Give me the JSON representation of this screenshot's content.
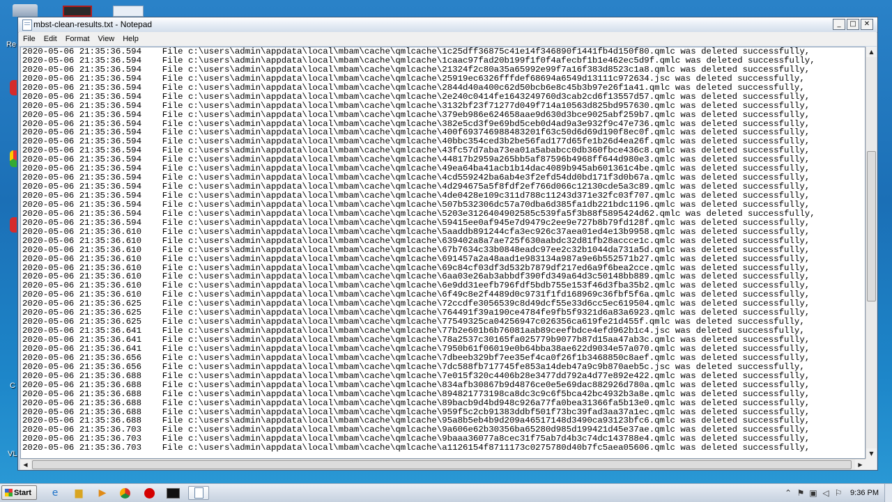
{
  "desktop": {
    "label_fragments": [
      "Re",
      "C",
      "VL"
    ]
  },
  "window": {
    "title": "mbst-clean-results.txt - Notepad",
    "menu": [
      "File",
      "Edit",
      "Format",
      "View",
      "Help"
    ],
    "controls": {
      "minimize": "_",
      "maximize": "□",
      "close": "✕"
    }
  },
  "editor": {
    "path_prefix": "c:\\users\\admin\\appdata\\local\\mbam\\cache\\qmlcache\\",
    "lines": [
      {
        "date": "2020-05-06",
        "time": "21:35:36.594",
        "file": "1c25dff36875c41e14f346890f1441fb4d150f80.qmlc",
        "status": "was deleted successfully,"
      },
      {
        "date": "2020-05-06",
        "time": "21:35:36.594",
        "file": "1caac97fad20b199f1f0f4afecbf1b1e462ec5d9f.qmlc",
        "status": "was deleted successfully,"
      },
      {
        "date": "2020-05-06",
        "time": "21:35:36.594",
        "file": "21324f2c80a35a65992e99f7a16f383d8523c1a8.qmlc",
        "status": "was deleted successfully,"
      },
      {
        "date": "2020-05-06",
        "time": "21:35:36.594",
        "file": "25919ec6326fffdef68694a6549d13111c972634.jsc",
        "status": "was deleted successfully,"
      },
      {
        "date": "2020-05-06",
        "time": "21:35:36.594",
        "file": "2844d40a400c62d50bcb6e8c45b3b97e26f1a41.qmlc",
        "status": "was deleted successfully,"
      },
      {
        "date": "2020-05-06",
        "time": "21:35:36.594",
        "file": "2e240c0414fe1643249760d3cab2cd6f13557d57.qmlc",
        "status": "was deleted successfully,"
      },
      {
        "date": "2020-05-06",
        "time": "21:35:36.594",
        "file": "3132bf23f71277d049f714a10563d825bd957630.qmlc",
        "status": "was deleted successfully,"
      },
      {
        "date": "2020-05-06",
        "time": "21:35:36.594",
        "file": "379eb986e624658aae9d630d3bce9025abf259b7.qmlc",
        "status": "was deleted successfully,"
      },
      {
        "date": "2020-05-06",
        "time": "21:35:36.594",
        "file": "382e5cd3f9e69bd5ceb0d4ad9a3e932f9c47e736.qmlc",
        "status": "was deleted successfully,"
      },
      {
        "date": "2020-05-06",
        "time": "21:35:36.594",
        "file": "400f693746988483201f63c50d6d69d190f8ec0f.qmlc",
        "status": "was deleted successfully,"
      },
      {
        "date": "2020-05-06",
        "time": "21:35:36.594",
        "file": "40bbc354ced3b2be56fad177d65fe1b26d4ea26f.qmlc",
        "status": "was deleted successfully,"
      },
      {
        "date": "2020-05-06",
        "time": "21:35:36.594",
        "file": "43fc57d7aba73ea01a5ababcc0db360fbce436c8.qmlc",
        "status": "was deleted successfully,"
      },
      {
        "date": "2020-05-06",
        "time": "21:35:36.594",
        "file": "44817b2959a265bb5af87596b4968ff644d980e3.qmlc",
        "status": "was deleted successfully,"
      },
      {
        "date": "2020-05-06",
        "time": "21:35:36.594",
        "file": "49ea64ba41acb1b14dac4089b945ab601361c4be.qmlc",
        "status": "was deleted successfully,"
      },
      {
        "date": "2020-05-06",
        "time": "21:35:36.594",
        "file": "4cd559242ba6ab4e3f2efd54dd0bd171f3d0b67a.qmlc",
        "status": "was deleted successfully,"
      },
      {
        "date": "2020-05-06",
        "time": "21:35:36.594",
        "file": "4d294675a5f8fdf2ef766d066c12130cde5a3c89.qmlc",
        "status": "was deleted successfully,"
      },
      {
        "date": "2020-05-06",
        "time": "21:35:36.594",
        "file": "4de0428e109c311d788c11243d371e32fc03f707.qmlc",
        "status": "was deleted successfully,"
      },
      {
        "date": "2020-05-06",
        "time": "21:35:36.594",
        "file": "507b532306dc57a70dba6d385fa1db221bdc1196.qmlc",
        "status": "was deleted successfully,"
      },
      {
        "date": "2020-05-06",
        "time": "21:35:36.594",
        "file": "5203e3126404902585c539fa5f3b88f5895424d62.qmlc",
        "status": "was deleted successfully,"
      },
      {
        "date": "2020-05-06",
        "time": "21:35:36.594",
        "file": "59415ee0af945e7d9479c2ee9e727b8b79fd128f.qmlc",
        "status": "was deleted successfully,"
      },
      {
        "date": "2020-05-06",
        "time": "21:35:36.610",
        "file": "5aaddb891244cfa3ec926c37aea01ed4e13b9958.qmlc",
        "status": "was deleted successfully,"
      },
      {
        "date": "2020-05-06",
        "time": "21:35:36.610",
        "file": "639402a8a7ae725f630aabdc32d81fb28accce1c.qmlc",
        "status": "was deleted successfully,"
      },
      {
        "date": "2020-05-06",
        "time": "21:35:36.610",
        "file": "67b7634c33b0848eadc97ee2c32b1044da731a5d.qmlc",
        "status": "was deleted successfully,"
      },
      {
        "date": "2020-05-06",
        "time": "21:35:36.610",
        "file": "691457a2a48aad1e983134a987a9e6b552571b27.qmlc",
        "status": "was deleted successfully,"
      },
      {
        "date": "2020-05-06",
        "time": "21:35:36.610",
        "file": "69c84cf03df3d532b7879df217ed6a9f6bea2cce.qmlc",
        "status": "was deleted successfully,"
      },
      {
        "date": "2020-05-06",
        "time": "21:35:36.610",
        "file": "6aa03e26ab3abbdf390fd349a64d3c50148bb889.qmlc",
        "status": "was deleted successfully,"
      },
      {
        "date": "2020-05-06",
        "time": "21:35:36.610",
        "file": "6e9dd31eefb796fdf5bdb755e153f46d3fba35b2.qmlc",
        "status": "was deleted successfully,"
      },
      {
        "date": "2020-05-06",
        "time": "21:35:36.610",
        "file": "6f49c8e2f4489d0c9731f1fd168969c36fbf5f6a.qmlc",
        "status": "was deleted successfully,"
      },
      {
        "date": "2020-05-06",
        "time": "21:35:36.625",
        "file": "72ccdfe3056539c8d49dcf55e33d6cc5ec619504.qmlc",
        "status": "was deleted successfully,"
      },
      {
        "date": "2020-05-06",
        "time": "21:35:36.625",
        "file": "764491f39a190ce4784fe9fb5f9321d6a83a6923.qmlc",
        "status": "was deleted successfully,"
      },
      {
        "date": "2020-05-06",
        "time": "21:35:36.625",
        "file": "77549325ca04256947c026356ca619fe21d455f.qmlc",
        "status": "was deleted successfully,"
      },
      {
        "date": "2020-05-06",
        "time": "21:35:36.641",
        "file": "77b2e601b6b76081aab89ceefbdce4efd962b1c4.jsc",
        "status": "was deleted successfully,"
      },
      {
        "date": "2020-05-06",
        "time": "21:35:36.641",
        "file": "78a2537c30165fa025779b9077b87d15aa47ab3c.qmlc",
        "status": "was deleted successfully,"
      },
      {
        "date": "2020-05-06",
        "time": "21:35:36.641",
        "file": "7950b61f06019e0b64bba38ae622d9034e57a070.qmlc",
        "status": "was deleted successfully,"
      },
      {
        "date": "2020-05-06",
        "time": "21:35:36.656",
        "file": "7dbeeb329bf7ee35ef4ca0f26f1b3468850c8aef.qmlc",
        "status": "was deleted successfully,"
      },
      {
        "date": "2020-05-06",
        "time": "21:35:36.656",
        "file": "7dc588fb717745fe853a14deb47a9c9b870aeb5c.jsc",
        "status": "was deleted successfully,"
      },
      {
        "date": "2020-05-06",
        "time": "21:35:36.688",
        "file": "7e015f320c4406b28e3477dd792a4d77e892e422.qmlc",
        "status": "was deleted successfully,"
      },
      {
        "date": "2020-05-06",
        "time": "21:35:36.688",
        "file": "834afb30867b9d4876ce0e5e69dac882926d780a.qmlc",
        "status": "was deleted successfully,"
      },
      {
        "date": "2020-05-06",
        "time": "21:35:36.688",
        "file": "894821773198ca8dc3c9c6f5bca42bc4932b3a8e.qmlc",
        "status": "was deleted successfully,"
      },
      {
        "date": "2020-05-06",
        "time": "21:35:36.688",
        "file": "89bacb9d4bd948c926a77fa0bea31366fa5b13e0.qmlc",
        "status": "was deleted successfully,"
      },
      {
        "date": "2020-05-06",
        "time": "21:35:36.688",
        "file": "959f5c2cb91383ddbf501f73bc39fad3aa37a1ec.qmlc",
        "status": "was deleted successfully,"
      },
      {
        "date": "2020-05-06",
        "time": "21:35:36.688",
        "file": "95a8b5eb4b9d209a46517148d3490ca93123bfc6.qmlc",
        "status": "was deleted successfully,"
      },
      {
        "date": "2020-05-06",
        "time": "21:35:36.703",
        "file": "9a606e62b30356ba65280d985d199421d45e37ae.qmlc",
        "status": "was deleted successfully,"
      },
      {
        "date": "2020-05-06",
        "time": "21:35:36.703",
        "file": "9baaa36077a8cec31f75ab7d4b3c74dc143788e4.qmlc",
        "status": "was deleted successfully,"
      },
      {
        "date": "2020-05-06",
        "time": "21:35:36.703",
        "file": "a1126154f8711173c0275780d40b7fc5aea05606.qmlc",
        "status": "was deleted successfully,"
      }
    ]
  },
  "taskbar": {
    "start_label": "Start",
    "clock": "9:36 PM",
    "apps": [
      "ie-icon",
      "explorer-icon",
      "media-player-icon",
      "chrome-icon",
      "stop-icon",
      "cmd-icon",
      "notepad-icon"
    ]
  }
}
